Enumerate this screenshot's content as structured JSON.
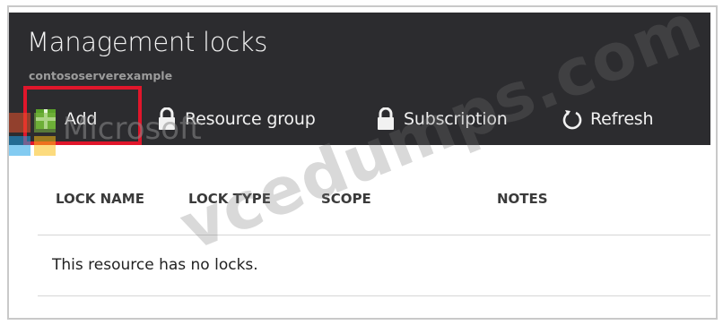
{
  "blade": {
    "title": "Management locks",
    "subtitle": "contososerverexample"
  },
  "toolbar": {
    "items": [
      {
        "label": "Add",
        "icon": "add-icon"
      },
      {
        "label": "Resource group",
        "icon": "lock-icon"
      },
      {
        "label": "Subscription",
        "icon": "lock-icon"
      },
      {
        "label": "Refresh",
        "icon": "refresh-icon"
      }
    ]
  },
  "table": {
    "columns": [
      "LOCK NAME",
      "LOCK TYPE",
      "SCOPE",
      "NOTES"
    ],
    "empty_message": "This resource has no locks."
  },
  "overlay": {
    "microsoft_text": "Microsoft",
    "watermark_text": "vcedumps.com"
  },
  "colors": {
    "header_bg": "#2c2c2f",
    "highlight": "#e0162b",
    "add_green": "#5ba32a"
  }
}
